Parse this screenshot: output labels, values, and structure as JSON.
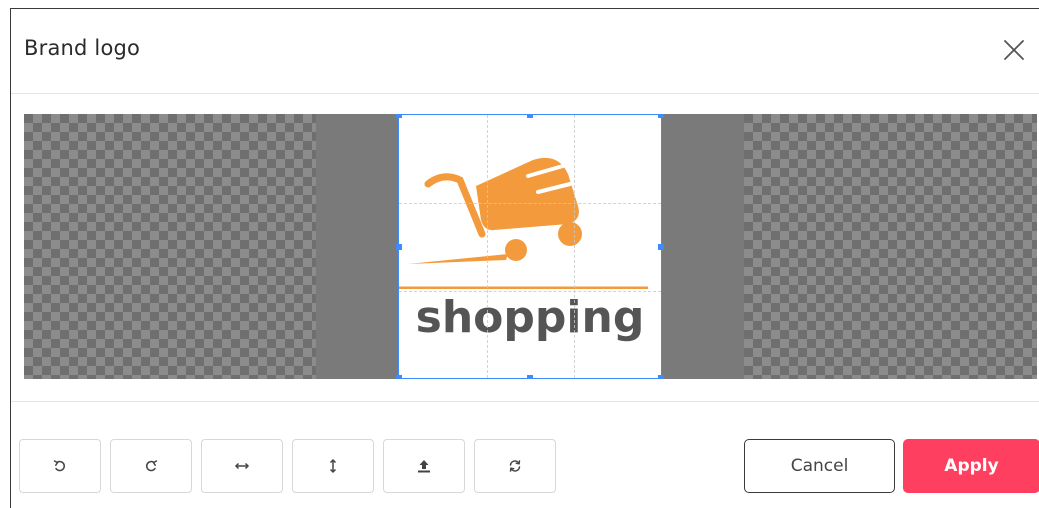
{
  "dialog": {
    "title": "Brand logo",
    "close_icon": "close-icon"
  },
  "image": {
    "logo_text": "shopping",
    "logo_icon": "shopping-cart-icon",
    "brand_color": "#f39a3c",
    "text_color": "#555555"
  },
  "toolbar": {
    "tools": [
      {
        "name": "rotate-left",
        "icon": "rotate-left-icon"
      },
      {
        "name": "rotate-right",
        "icon": "rotate-right-icon"
      },
      {
        "name": "flip-horizontal",
        "icon": "flip-horizontal-icon"
      },
      {
        "name": "flip-vertical",
        "icon": "flip-vertical-icon"
      },
      {
        "name": "upload",
        "icon": "upload-icon"
      },
      {
        "name": "reset",
        "icon": "reset-icon"
      }
    ],
    "cancel_label": "Cancel",
    "apply_label": "Apply"
  },
  "colors": {
    "accent": "#ff3f5f",
    "crop_border": "#3d8bff"
  }
}
